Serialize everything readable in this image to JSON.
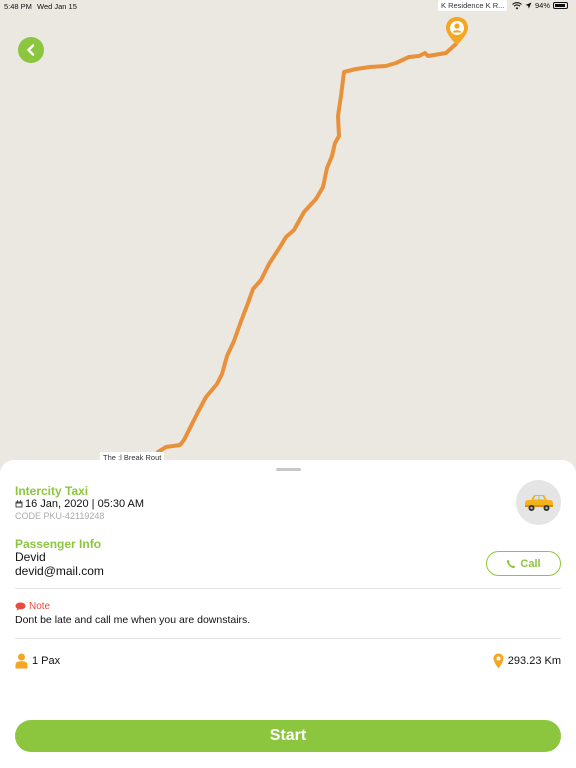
{
  "status_bar": {
    "time": "5:48 PM",
    "date": "Wed Jan 15",
    "battery": "94%",
    "icons": [
      "wifi-icon",
      "location-arrow-icon",
      "battery-charging-icon"
    ]
  },
  "map": {
    "destination_label": "K Residence K R...",
    "origin_label": "The :l Break Rout",
    "route_color": "#e8913a",
    "marker_color": "#f5a623"
  },
  "trip": {
    "title": "Intercity Taxi",
    "date_time": "16 Jan, 2020 | 05:30 AM",
    "code": "CODE PKU-42119248",
    "vehicle_icon": "taxi-icon"
  },
  "passenger": {
    "section_title": "Passenger Info",
    "name": "Devid",
    "email": "devid@mail.com",
    "call_label": "Call"
  },
  "note": {
    "label": "Note",
    "text": "Dont be late and call me when you are downstairs."
  },
  "summary": {
    "pax": "1 Pax",
    "distance": "293.23 Km"
  },
  "actions": {
    "start_label": "Start"
  },
  "colors": {
    "accent": "#8cc63e",
    "note": "#e84c3d",
    "marker": "#f5a623"
  }
}
